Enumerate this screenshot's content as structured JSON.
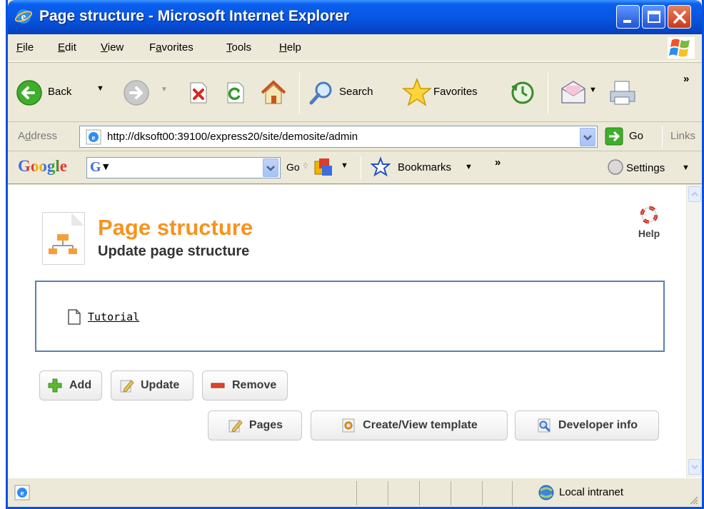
{
  "window": {
    "title": "Page structure - Microsoft Internet Explorer"
  },
  "menu": {
    "items": [
      {
        "first": "F",
        "rest": "ile"
      },
      {
        "first": "E",
        "rest": "dit"
      },
      {
        "first": "V",
        "rest": "iew"
      },
      {
        "first": "F",
        "pre": "",
        "label_full": "Favorites",
        "u_index": 1
      },
      {
        "first": "T",
        "rest": "ools"
      },
      {
        "first": "H",
        "rest": "elp"
      }
    ],
    "favorites_pre": "F",
    "favorites_u": "a",
    "favorites_post": "vorites"
  },
  "toolbar": {
    "back": "Back",
    "search": "Search",
    "favorites": "Favorites",
    "chevron": "»"
  },
  "address": {
    "label_pre": "A",
    "label_u": "d",
    "label_post": "dress",
    "url": "http://dksoft00:39100/express20/site/demosite/admin",
    "go": "Go",
    "links": "Links"
  },
  "googlebar": {
    "logo": "Google",
    "go": "Go",
    "bookmarks": "Bookmarks",
    "chevron": "»",
    "settings": "Settings"
  },
  "page": {
    "title": "Page structure",
    "subtitle": "Update page structure",
    "help": "Help",
    "tree": [
      {
        "label": "Tutorial"
      }
    ],
    "buttons": {
      "add": "Add",
      "update": "Update",
      "remove": "Remove",
      "pages": "Pages",
      "template": "Create/View template",
      "developer": "Developer info"
    }
  },
  "status": {
    "zone": "Local intranet"
  },
  "colors": {
    "title_orange": "#F7931E",
    "xp_blue": "#0A50DE",
    "tree_border": "#5A7EB5"
  }
}
